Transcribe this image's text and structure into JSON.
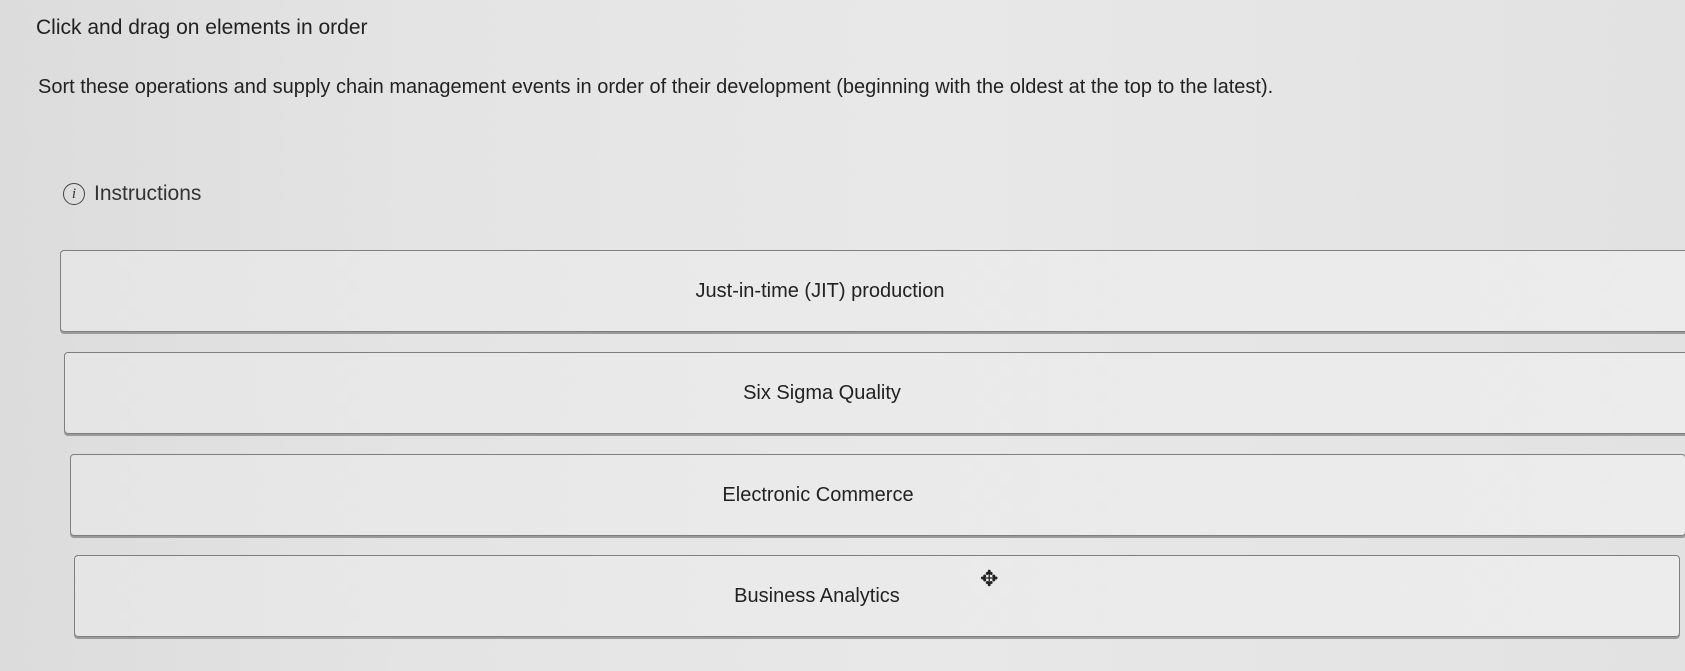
{
  "header": {
    "title": "Click and drag on elements in order"
  },
  "question": {
    "prompt": "Sort these operations and supply chain management events in order of their development (beginning with the oldest at the top to the latest)."
  },
  "instructions": {
    "label": "Instructions",
    "icon": "info-icon"
  },
  "items": [
    {
      "label": "Just-in-time (JIT) production"
    },
    {
      "label": "Six Sigma Quality"
    },
    {
      "label": "Electronic Commerce"
    },
    {
      "label": "Business Analytics"
    }
  ],
  "cursor": {
    "icon": "move-cursor-icon"
  }
}
